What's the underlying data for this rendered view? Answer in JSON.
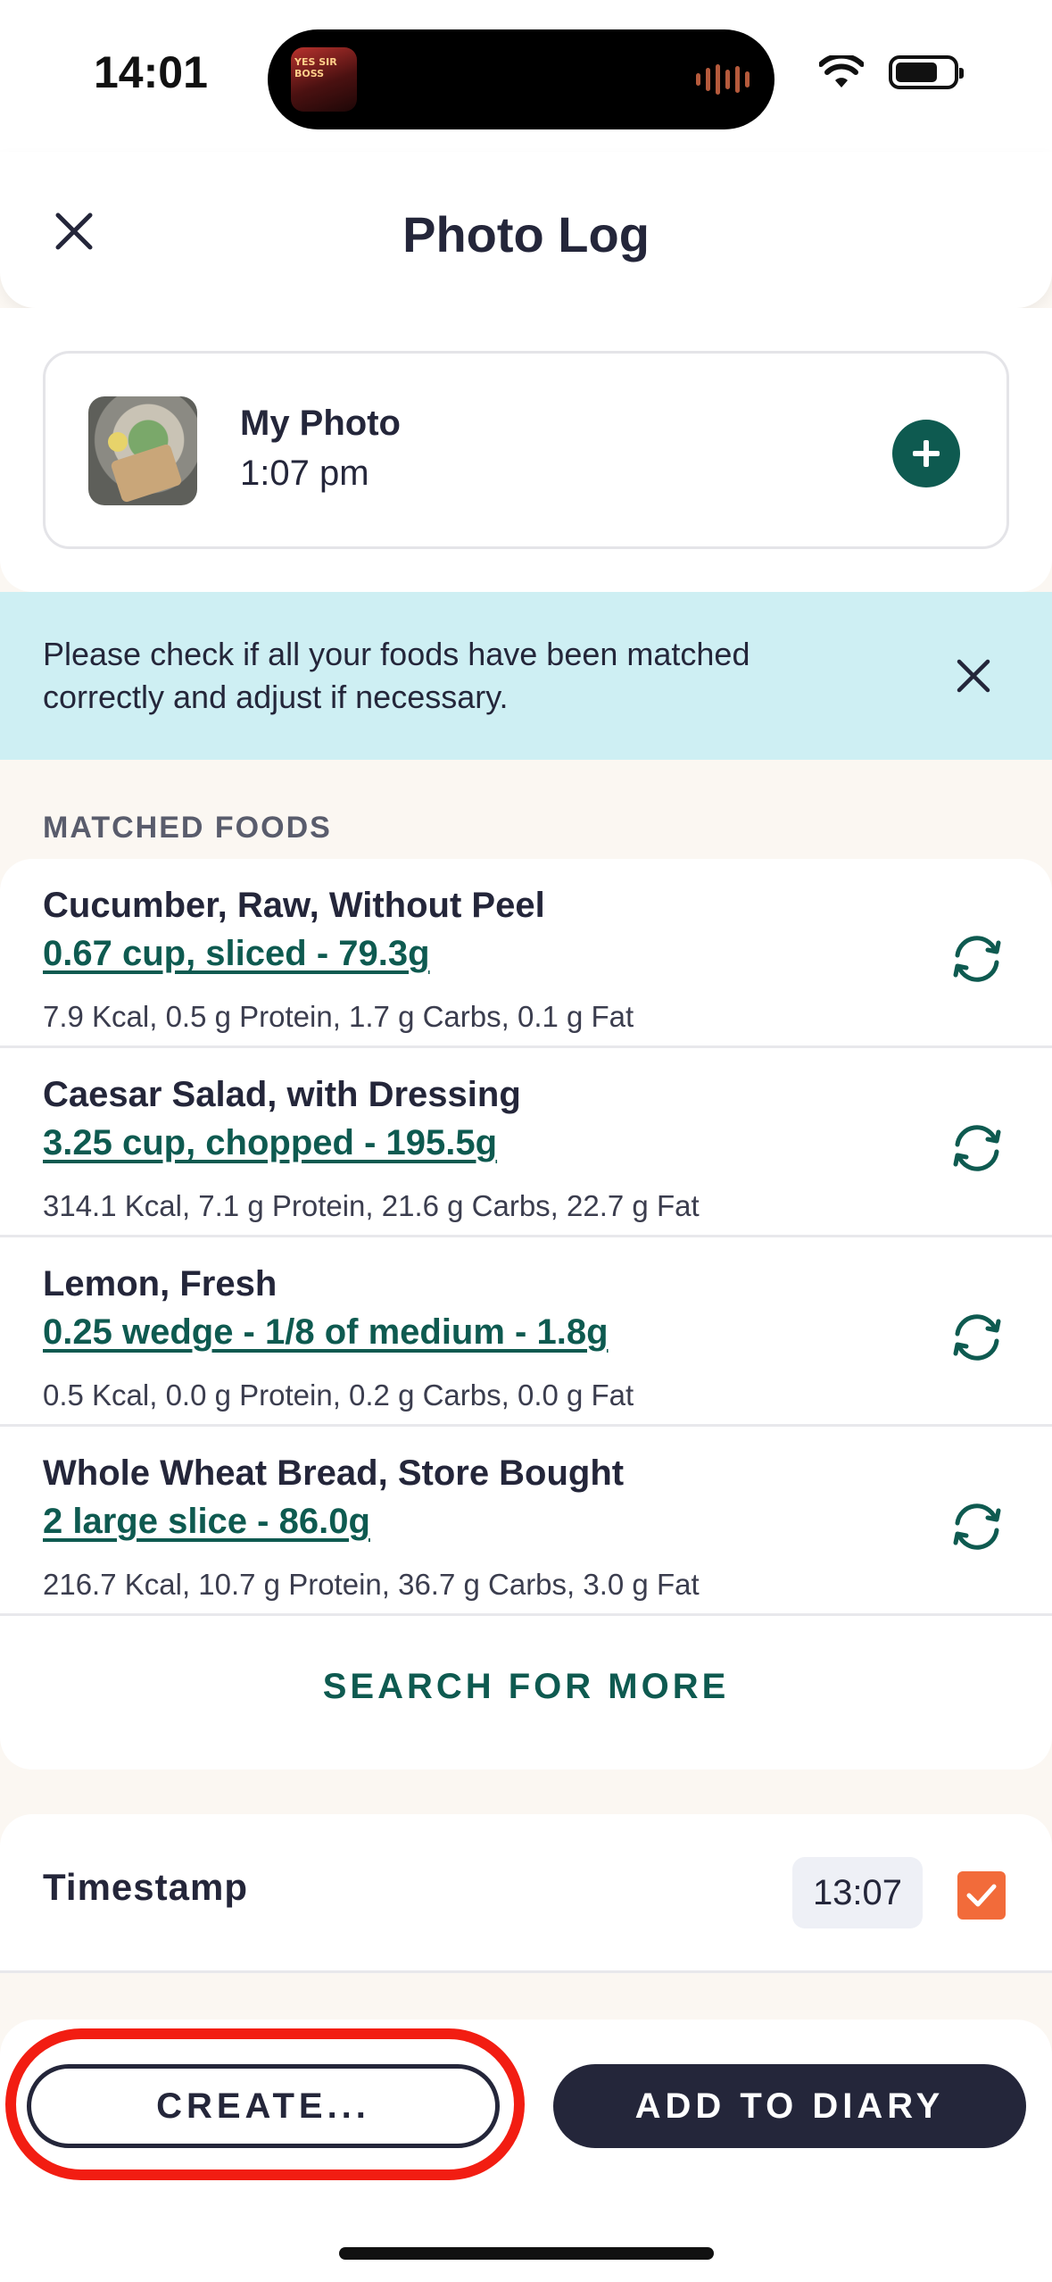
{
  "status_bar": {
    "time": "14:01",
    "island_art_text": "YES SIR BOSS"
  },
  "header": {
    "title": "Photo Log",
    "close_icon": "close-icon"
  },
  "photo": {
    "name": "My Photo",
    "time": "1:07 pm",
    "add_icon": "plus-icon"
  },
  "banner": {
    "message": "Please check if all your foods have been matched correctly and adjust if necessary."
  },
  "matched_foods": {
    "section_label": "MATCHED FOODS",
    "items": [
      {
        "name": "Cucumber, Raw, Without Peel",
        "portion": "0.67 cup, sliced - 79.3g",
        "macros": "7.9 Kcal, 0.5 g Protein, 1.7 g Carbs, 0.1 g Fat"
      },
      {
        "name": "Caesar Salad, with Dressing",
        "portion": "3.25 cup, chopped - 195.5g",
        "macros": "314.1 Kcal, 7.1 g Protein, 21.6 g Carbs, 22.7 g Fat"
      },
      {
        "name": "Lemon, Fresh",
        "portion": "0.25 wedge - 1/8 of medium - 1.8g",
        "macros": "0.5 Kcal, 0.0 g Protein, 0.2 g Carbs, 0.0 g Fat"
      },
      {
        "name": "Whole Wheat Bread, Store Bought",
        "portion": "2 large slice - 86.0g",
        "macros": "216.7 Kcal, 10.7 g Protein, 36.7 g Carbs, 3.0 g Fat"
      }
    ],
    "search_more_label": "SEARCH FOR MORE"
  },
  "timestamp": {
    "label": "Timestamp",
    "value": "13:07",
    "checked": true
  },
  "actions": {
    "create_label": "CREATE...",
    "add_to_diary_label": "ADD TO DIARY"
  },
  "colors": {
    "accent_teal": "#0e5a50",
    "dark_navy": "#24263a",
    "banner_bg": "#ceeff3",
    "checkbox_orange": "#f26b3a",
    "highlight_red": "#f21d12"
  }
}
